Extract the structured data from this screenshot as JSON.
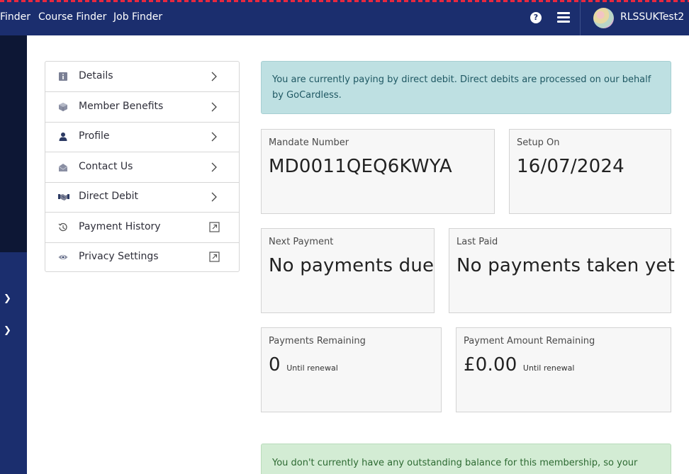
{
  "topnav": {
    "items": [
      "Finder",
      "Course Finder",
      "Job Finder"
    ],
    "help_icon": "question-circle-icon",
    "menu_icon": "hamburger-menu-icon",
    "username": "RLSSUKTest2"
  },
  "sidebar": {
    "items": [
      {
        "label": "Details",
        "icon": "info-icon",
        "action": "chevron-right-icon"
      },
      {
        "label": "Member Benefits",
        "icon": "box-icon",
        "action": "chevron-right-icon"
      },
      {
        "label": "Profile",
        "icon": "person-icon",
        "action": "chevron-right-icon"
      },
      {
        "label": "Contact Us",
        "icon": "envelope-open-icon",
        "action": "chevron-right-icon"
      },
      {
        "label": "Direct Debit",
        "icon": "handshake-icon",
        "action": "chevron-right-icon"
      },
      {
        "label": "Payment History",
        "icon": "history-icon",
        "action": "external-link-icon"
      },
      {
        "label": "Privacy Settings",
        "icon": "eye-icon",
        "action": "external-link-icon"
      }
    ]
  },
  "info_banner": {
    "text": "You are currently paying by direct debit. Direct debits are processed on our behalf by GoCardless."
  },
  "cards": {
    "mandate": {
      "label": "Mandate Number",
      "value": "MD0011QEQ6KWYA"
    },
    "setup": {
      "label": "Setup On",
      "value": "16/07/2024"
    },
    "next_payment": {
      "label": "Next Payment",
      "value": "No payments due"
    },
    "last_paid": {
      "label": "Last Paid",
      "value": "No payments taken yet"
    },
    "payments_remaining": {
      "label": "Payments Remaining",
      "value": "0",
      "sub": "Until renewal"
    },
    "amount_remaining": {
      "label": "Payment Amount Remaining",
      "value": "£0.00",
      "sub": "Until renewal"
    }
  },
  "success_banner": {
    "text": "You don't currently have any outstanding balance for this membership, so your direct"
  },
  "colors": {
    "navy": "#1b2e6e",
    "dark_strip": "#0d1735",
    "info_bg": "#bee0e2",
    "success_bg": "#d3ecd4",
    "accent_red": "#e8283f"
  }
}
